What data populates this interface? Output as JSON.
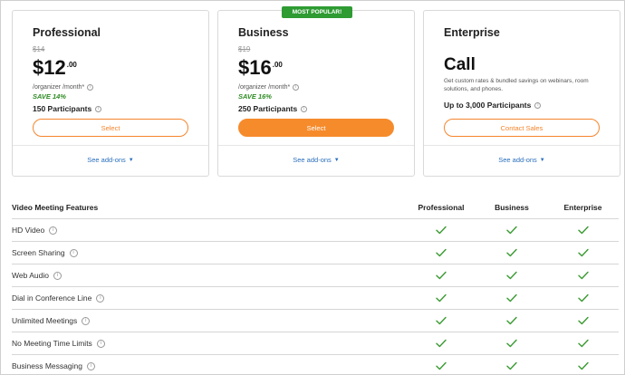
{
  "plans": [
    {
      "name": "Professional",
      "old_price": "$14",
      "price_main": "$12",
      "price_cents": ".00",
      "per_org": "/organizer /month*",
      "save": "SAVE 14%",
      "participants": "150 Participants",
      "button_label": "Select",
      "addons_label": "See add-ons"
    },
    {
      "name": "Business",
      "badge": "MOST POPULAR!",
      "old_price": "$19",
      "price_main": "$16",
      "price_cents": ".00",
      "per_org": "/organizer /month*",
      "save": "SAVE 16%",
      "participants": "250 Participants",
      "button_label": "Select",
      "addons_label": "See add-ons"
    },
    {
      "name": "Enterprise",
      "price_main": "Call",
      "description": "Get custom rates & bundled savings on webinars, room solutions, and phones.",
      "participants": "Up to 3,000 Participants",
      "button_label": "Contact Sales",
      "addons_label": "See add-ons"
    }
  ],
  "table": {
    "header": "Video Meeting Features",
    "columns": [
      "Professional",
      "Business",
      "Enterprise"
    ],
    "rows": [
      {
        "feature": "HD Video",
        "included": [
          true,
          true,
          true
        ]
      },
      {
        "feature": "Screen Sharing",
        "included": [
          true,
          true,
          true
        ]
      },
      {
        "feature": "Web Audio",
        "included": [
          true,
          true,
          true
        ]
      },
      {
        "feature": "Dial in Conference Line",
        "included": [
          true,
          true,
          true
        ]
      },
      {
        "feature": "Unlimited Meetings",
        "included": [
          true,
          true,
          true
        ]
      },
      {
        "feature": "No Meeting Time Limits",
        "included": [
          true,
          true,
          true
        ]
      },
      {
        "feature": "Business Messaging",
        "included": [
          true,
          true,
          true
        ]
      }
    ]
  },
  "colors": {
    "accent_orange": "#f68b2c",
    "badge_green": "#2e9b33",
    "save_green": "#2e8b24",
    "check_green": "#3a9a32",
    "link_blue": "#2a6fbd"
  },
  "icons": [
    "info-icon",
    "chevron-down-icon",
    "checkmark-icon"
  ]
}
